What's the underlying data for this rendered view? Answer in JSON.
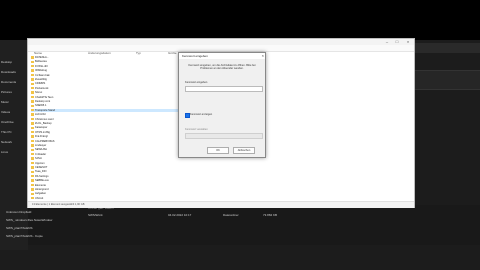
{
  "background_window": {
    "sidebar_items": [
      "Desktop",
      "Downloads",
      "Documents",
      "Pictures",
      "Music",
      "Videos",
      "OneDrive",
      "This PC",
      "Network",
      "Linux"
    ],
    "lower_left_items": [
      "Unknown Dropfield",
      "SWS_ windows.files.NotesWindow",
      "SWS_plan/TALENS",
      "SWS_plan/TALENS - Kopie"
    ],
    "lower_header": "Ordner geb. Datum",
    "lower_row": {
      "name": "SWS/Work",
      "date": "04.02.2022 10:17",
      "type": "Dateiordner",
      "size": "73.884 KB"
    }
  },
  "window": {
    "status_text": "13 Elemente  |  1 Element ausgewählt  1,90 GB",
    "columns": [
      "Name",
      "Änderungsdatum",
      "Typ",
      "Größe"
    ],
    "rows": [
      {
        "name": "DATENLA...",
        "selected": false
      },
      {
        "name": "BoDeerea",
        "selected": false
      },
      {
        "name": "FOSSL.dill",
        "selected": false
      },
      {
        "name": "IDSDebug",
        "selected": false
      },
      {
        "name": "CoTeam.bak",
        "selected": false
      },
      {
        "name": "Zusatzbilg",
        "selected": false
      },
      {
        "name": "CDIMRS",
        "selected": false
      },
      {
        "name": "PocketLock",
        "selected": false
      },
      {
        "name": "Sirevc",
        "selected": false
      },
      {
        "name": "ChatGPTa Teen",
        "selected": false
      },
      {
        "name": "Desktop cont",
        "selected": false
      },
      {
        "name": "SNEW5.1",
        "selected": false
      },
      {
        "name": "Transporte Stand",
        "selected": true
      },
      {
        "name": "LtchnOld",
        "selected": false
      },
      {
        "name": "ChrisLinux.xaml",
        "selected": false
      },
      {
        "name": "ZLOL_Backup",
        "selected": false
      },
      {
        "name": "Kaisetoper",
        "selected": false
      },
      {
        "name": "OTRS.ini.Big",
        "selected": false
      },
      {
        "name": "D.E.D.Engl",
        "selected": false
      },
      {
        "name": "CALPREBV.BAS",
        "selected": false
      },
      {
        "name": "Lindsayer",
        "selected": false
      },
      {
        "name": "SEWA.Bio",
        "selected": false
      },
      {
        "name": "C.Reader",
        "selected": false
      },
      {
        "name": "SJSnt",
        "selected": false
      },
      {
        "name": "Uppcom",
        "selected": false
      },
      {
        "name": "CESESOT",
        "selected": false
      },
      {
        "name": "Tsaa_DIO",
        "selected": false
      },
      {
        "name": "Rb-Settings",
        "selected": false
      },
      {
        "name": "SEBBle.exe",
        "selected": false
      },
      {
        "name": "Elemente",
        "selected": false
      },
      {
        "name": "Hintergrund",
        "selected": false
      },
      {
        "name": "Aufgaben",
        "selected": false
      },
      {
        "name": "Uhrzeit",
        "selected": false
      }
    ]
  },
  "dialog": {
    "title": "Kennwort eingeben",
    "message": "Kennwort eingeben, um die Archivdatei zu öffnen. Bitte bei Problemen an den Absender wenden.",
    "field_label": "Kennwort eingeben",
    "checkbox_label": "Kennwort anzeigen",
    "pw_label": "Kennwort verwalten",
    "ok_label": "OK",
    "cancel_label": "Abbrechen",
    "accent": "#1a73e8"
  }
}
